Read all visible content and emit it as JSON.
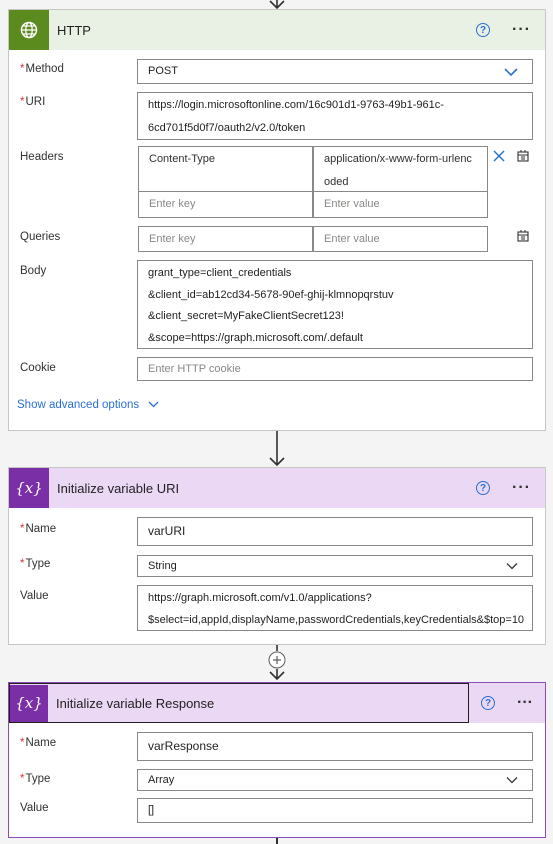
{
  "http": {
    "title": "HTTP",
    "icon": "globe-icon",
    "method_label": "Method",
    "method_value": "POST",
    "uri_label": "URI",
    "uri_lines": [
      "https://login.microsoftonline.com/16c901d1-9763-49b1-961c-",
      "6cd701f5d0f7/oauth2/v2.0/token"
    ],
    "headers_label": "Headers",
    "header_key": "Content-Type",
    "header_value_lines": [
      "application/x-www-form-urlenc",
      "oded"
    ],
    "enter_key": "Enter key",
    "enter_value": "Enter value",
    "queries_label": "Queries",
    "body_label": "Body",
    "body_lines": [
      "grant_type=client_credentials",
      "&client_id=ab12cd34-5678-90ef-ghij-klmnopqrstuv",
      "&client_secret=MyFakeClientSecret123!",
      "&scope=https://graph.microsoft.com/.default"
    ],
    "cookie_label": "Cookie",
    "cookie_placeholder": "Enter HTTP cookie",
    "show_advanced": "Show advanced options"
  },
  "var_uri": {
    "title": "Initialize variable URI",
    "name_label": "Name",
    "name_value": "varURI",
    "type_label": "Type",
    "type_value": "String",
    "value_label": "Value",
    "value_lines": [
      "https://graph.microsoft.com/v1.0/applications?",
      "$select=id,appId,displayName,passwordCredentials,keyCredentials&$top=10"
    ]
  },
  "var_response": {
    "title": "Initialize variable Response",
    "name_label": "Name",
    "name_value": "varResponse",
    "type_label": "Type",
    "type_value": "Array",
    "value_label": "Value",
    "value_value": "[]"
  },
  "help_glyph": "?",
  "more_glyph": "···",
  "colors": {
    "accent": "#2b6fd6",
    "http_header": "#e9f1e4",
    "var_header": "#ead8f5",
    "required": "#d13438",
    "selected_border": "#8a4ab8"
  }
}
